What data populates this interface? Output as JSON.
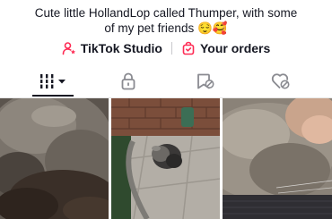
{
  "profile": {
    "bio_line1": "Cute little HollandLop called Thumper, with some",
    "bio_line2": "of my pet friends 😌🥰"
  },
  "links": {
    "studio_label": "TikTok Studio",
    "orders_label": "Your orders",
    "studio_icon": "person-star-icon",
    "orders_icon": "shopping-bag-icon",
    "accent_color": "#fe2c55"
  },
  "tabs": [
    {
      "icon": "videos-grid-icon",
      "selected": true
    },
    {
      "icon": "lock-icon",
      "selected": false
    },
    {
      "icon": "bookmark-icon",
      "selected": false
    },
    {
      "icon": "liked-heart-icon",
      "selected": false
    }
  ],
  "videos": [
    {
      "thumbnail": "grey rabbit close-up"
    },
    {
      "thumbnail": "grey rabbit on patio"
    },
    {
      "thumbnail": "rabbit being petted"
    }
  ]
}
